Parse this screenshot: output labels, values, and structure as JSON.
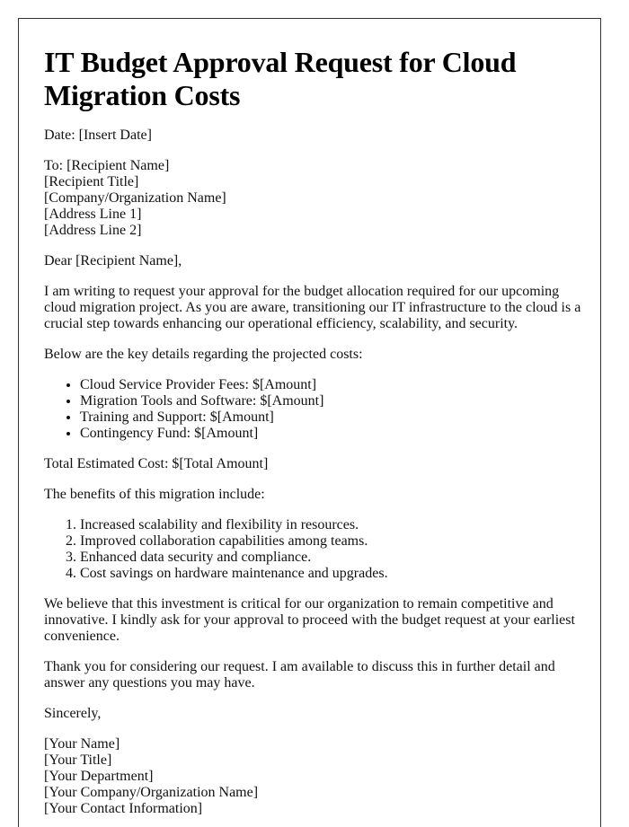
{
  "title": "IT Budget Approval Request for Cloud Migration Costs",
  "date_line": "Date: [Insert Date]",
  "recipient_lines": [
    "To: [Recipient Name]",
    "[Recipient Title]",
    "[Company/Organization Name]",
    "[Address Line 1]",
    "[Address Line 2]"
  ],
  "salutation": "Dear [Recipient Name],",
  "intro_paragraph": "I am writing to request your approval for the budget allocation required for our upcoming cloud migration project. As you are aware, transitioning our IT infrastructure to the cloud is a crucial step towards enhancing our operational efficiency, scalability, and security.",
  "costs_intro": "Below are the key details regarding the projected costs:",
  "cost_items": [
    "Cloud Service Provider Fees: $[Amount]",
    "Migration Tools and Software: $[Amount]",
    "Training and Support: $[Amount]",
    "Contingency Fund: $[Amount]"
  ],
  "total_line": "Total Estimated Cost: $[Total Amount]",
  "benefits_intro": "The benefits of this migration include:",
  "benefit_items": [
    "Increased scalability and flexibility in resources.",
    "Improved collaboration capabilities among teams.",
    "Enhanced data security and compliance.",
    "Cost savings on hardware maintenance and upgrades."
  ],
  "belief_paragraph": "We believe that this investment is critical for our organization to remain competitive and innovative. I kindly ask for your approval to proceed with the budget request at your earliest convenience.",
  "thanks_paragraph": "Thank you for considering our request. I am available to discuss this in further detail and answer any questions you may have.",
  "closing": "Sincerely,",
  "signature_lines": [
    "[Your Name]",
    "[Your Title]",
    "[Your Department]",
    "[Your Company/Organization Name]",
    "[Your Contact Information]"
  ]
}
